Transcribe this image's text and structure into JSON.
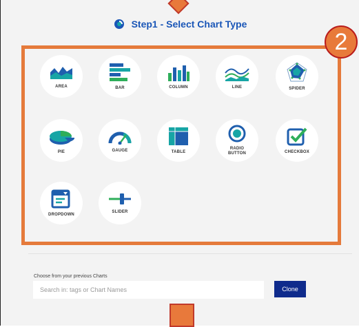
{
  "header": {
    "title": "Step1 - Select Chart Type",
    "logo_icon": "logo-icon"
  },
  "step_badge": "2",
  "chart_types": [
    {
      "label": "AREA",
      "icon": "area-chart-icon"
    },
    {
      "label": "BAR",
      "icon": "bar-chart-icon"
    },
    {
      "label": "COLUMN",
      "icon": "column-chart-icon"
    },
    {
      "label": "LINE",
      "icon": "line-chart-icon"
    },
    {
      "label": "SPIDER",
      "icon": "spider-chart-icon"
    },
    {
      "label": "PIE",
      "icon": "pie-chart-icon"
    },
    {
      "label": "GAUGE",
      "icon": "gauge-icon"
    },
    {
      "label": "TABLE",
      "icon": "table-icon"
    },
    {
      "label": "RADIO BUTTON",
      "icon": "radio-button-icon"
    },
    {
      "label": "CHECKBOX",
      "icon": "checkbox-icon"
    },
    {
      "label": "DROPDOWN",
      "icon": "dropdown-icon"
    },
    {
      "label": "SLIDER",
      "icon": "slider-icon"
    }
  ],
  "previous": {
    "label": "Choose from your previous Charts",
    "search_placeholder": "Search in: tags or Chart Names",
    "search_value": "",
    "clone_label": "Clone"
  },
  "colors": {
    "accent": "#1a56b7",
    "orange": "#e57a3b",
    "clone": "#0f2b8c",
    "icon_dark": "#1f5fae",
    "icon_teal": "#17a5a5",
    "icon_green": "#2eae5a"
  }
}
